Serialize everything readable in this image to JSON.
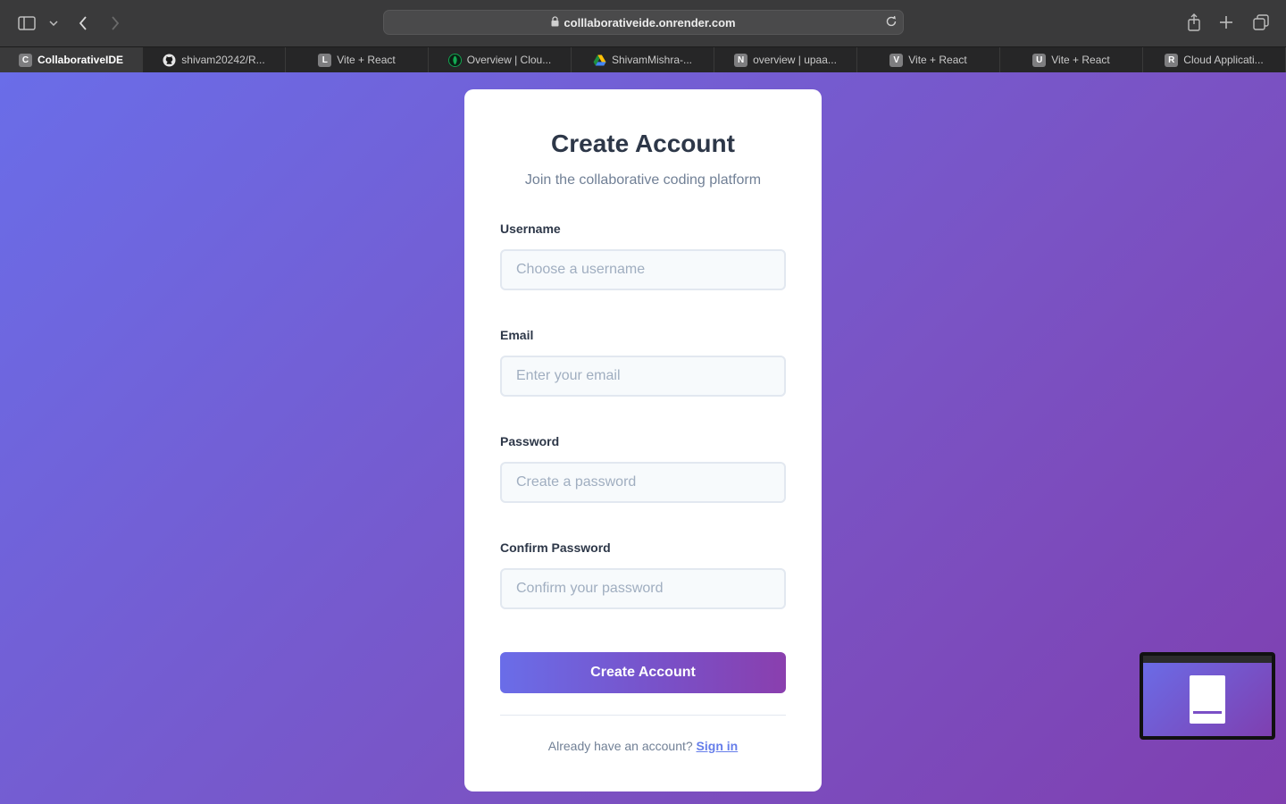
{
  "browser": {
    "url": "colllaborativeide.onrender.com",
    "tabs": [
      {
        "label": "CollaborativeIDE",
        "favicon": "C",
        "active": true
      },
      {
        "label": "shivam20242/R...",
        "favicon": "github-icon"
      },
      {
        "label": "Vite + React",
        "favicon": "L"
      },
      {
        "label": "Overview | Clou...",
        "favicon": "leaf-icon"
      },
      {
        "label": "ShivamMishra-...",
        "favicon": "drive-icon"
      },
      {
        "label": "overview | upaa...",
        "favicon": "N"
      },
      {
        "label": "Vite + React",
        "favicon": "V"
      },
      {
        "label": "Vite + React",
        "favicon": "U"
      },
      {
        "label": "Cloud Applicati...",
        "favicon": "R"
      }
    ]
  },
  "form": {
    "title": "Create Account",
    "subtitle": "Join the collaborative coding platform",
    "fields": [
      {
        "label": "Username",
        "placeholder": "Choose a username",
        "value": ""
      },
      {
        "label": "Email",
        "placeholder": "Enter your email",
        "value": ""
      },
      {
        "label": "Password",
        "placeholder": "Create a password",
        "value": ""
      },
      {
        "label": "Confirm Password",
        "placeholder": "Confirm your password",
        "value": ""
      }
    ],
    "submit_label": "Create Account",
    "footer_text": "Already have an account?",
    "footer_link": "Sign in"
  },
  "colors": {
    "gradient_start": "#6a6de8",
    "gradient_end": "#7f3fb0",
    "title_text": "#2d3748",
    "link": "#667eea"
  }
}
